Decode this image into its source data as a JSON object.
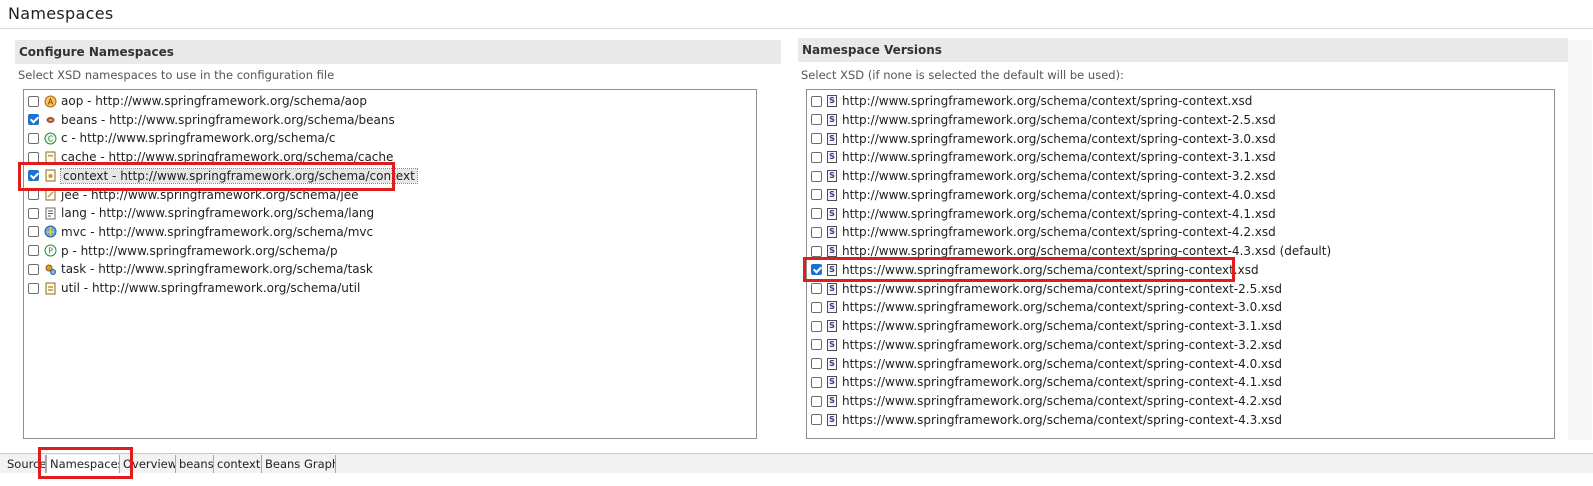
{
  "page": {
    "title": "Namespaces"
  },
  "left": {
    "header": "Configure Namespaces",
    "description": "Select XSD namespaces to use in the configuration file",
    "items": [
      {
        "label": "aop - http://www.springframework.org/schema/aop",
        "checked": false,
        "icon": "aop-icon"
      },
      {
        "label": "beans - http://www.springframework.org/schema/beans",
        "checked": true,
        "icon": "beans-icon"
      },
      {
        "label": "c - http://www.springframework.org/schema/c",
        "checked": false,
        "icon": "c-icon"
      },
      {
        "label": "cache - http://www.springframework.org/schema/cache",
        "checked": false,
        "icon": "cache-icon"
      },
      {
        "label": "context - http://www.springframework.org/schema/context",
        "checked": true,
        "icon": "context-icon",
        "selected": true
      },
      {
        "label": "jee - http://www.springframework.org/schema/jee",
        "checked": false,
        "icon": "jee-icon"
      },
      {
        "label": "lang - http://www.springframework.org/schema/lang",
        "checked": false,
        "icon": "lang-icon"
      },
      {
        "label": "mvc - http://www.springframework.org/schema/mvc",
        "checked": false,
        "icon": "mvc-icon"
      },
      {
        "label": "p - http://www.springframework.org/schema/p",
        "checked": false,
        "icon": "p-icon"
      },
      {
        "label": "task - http://www.springframework.org/schema/task",
        "checked": false,
        "icon": "task-icon"
      },
      {
        "label": "util - http://www.springframework.org/schema/util",
        "checked": false,
        "icon": "util-icon"
      }
    ]
  },
  "right": {
    "header": "Namespace Versions",
    "description": "Select XSD (if none is selected the default will be used):",
    "items": [
      {
        "label": "http://www.springframework.org/schema/context/spring-context.xsd",
        "checked": false
      },
      {
        "label": "http://www.springframework.org/schema/context/spring-context-2.5.xsd",
        "checked": false
      },
      {
        "label": "http://www.springframework.org/schema/context/spring-context-3.0.xsd",
        "checked": false
      },
      {
        "label": "http://www.springframework.org/schema/context/spring-context-3.1.xsd",
        "checked": false
      },
      {
        "label": "http://www.springframework.org/schema/context/spring-context-3.2.xsd",
        "checked": false
      },
      {
        "label": "http://www.springframework.org/schema/context/spring-context-4.0.xsd",
        "checked": false
      },
      {
        "label": "http://www.springframework.org/schema/context/spring-context-4.1.xsd",
        "checked": false
      },
      {
        "label": "http://www.springframework.org/schema/context/spring-context-4.2.xsd",
        "checked": false
      },
      {
        "label": "http://www.springframework.org/schema/context/spring-context-4.3.xsd (default)",
        "checked": false
      },
      {
        "label": "https://www.springframework.org/schema/context/spring-context.xsd",
        "checked": true
      },
      {
        "label": "https://www.springframework.org/schema/context/spring-context-2.5.xsd",
        "checked": false
      },
      {
        "label": "https://www.springframework.org/schema/context/spring-context-3.0.xsd",
        "checked": false
      },
      {
        "label": "https://www.springframework.org/schema/context/spring-context-3.1.xsd",
        "checked": false
      },
      {
        "label": "https://www.springframework.org/schema/context/spring-context-3.2.xsd",
        "checked": false
      },
      {
        "label": "https://www.springframework.org/schema/context/spring-context-4.0.xsd",
        "checked": false
      },
      {
        "label": "https://www.springframework.org/schema/context/spring-context-4.1.xsd",
        "checked": false
      },
      {
        "label": "https://www.springframework.org/schema/context/spring-context-4.2.xsd",
        "checked": false
      },
      {
        "label": "https://www.springframework.org/schema/context/spring-context-4.3.xsd",
        "checked": false
      }
    ],
    "xsd_icon_letter": "S"
  },
  "tabs": [
    {
      "label": "Source",
      "active": false
    },
    {
      "label": "Namespaces",
      "active": true
    },
    {
      "label": "Overview",
      "active": false
    },
    {
      "label": "beans",
      "active": false
    },
    {
      "label": "context",
      "active": false
    },
    {
      "label": "Beans Graph",
      "active": false
    }
  ],
  "colors": {
    "highlight": "#e01d1d",
    "checkbox_checked": "#1a73d2"
  }
}
